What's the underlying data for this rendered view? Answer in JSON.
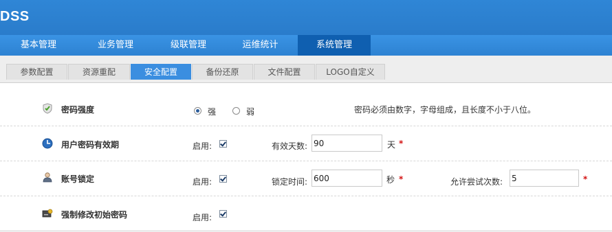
{
  "app": {
    "logo": "DSS"
  },
  "nav": {
    "items": [
      {
        "label": "基本管理"
      },
      {
        "label": "业务管理"
      },
      {
        "label": "级联管理"
      },
      {
        "label": "运维统计"
      },
      {
        "label": "系统管理"
      }
    ],
    "active": "系统管理"
  },
  "subnav": {
    "tabs": [
      {
        "label": "参数配置"
      },
      {
        "label": "资源重配"
      },
      {
        "label": "安全配置"
      },
      {
        "label": "备份还原"
      },
      {
        "label": "文件配置"
      },
      {
        "label": "LOGO自定义"
      }
    ],
    "active": "安全配置"
  },
  "password_strength": {
    "title": "密码强度",
    "options": [
      {
        "label": "强",
        "selected": true
      },
      {
        "label": "弱",
        "selected": false
      }
    ],
    "hint": "密码必须由数字，字母组成，且长度不小于八位。"
  },
  "password_expiry": {
    "title": "用户密码有效期",
    "enable_label": "启用:",
    "enabled": true,
    "days_label": "有效天数:",
    "days_value": "90",
    "days_unit": "天",
    "required_mark": "*"
  },
  "account_lock": {
    "title": "账号锁定",
    "enable_label": "启用:",
    "enabled": true,
    "lock_time_label": "锁定时间:",
    "lock_time_value": "600",
    "lock_time_unit": "秒",
    "attempts_label": "允许尝试次数:",
    "attempts_value": "5",
    "required_mark": "*"
  },
  "force_change": {
    "title": "强制修改初始密码",
    "enable_label": "启用:",
    "enabled": true
  },
  "colors": {
    "header_blue": "#2f86d6",
    "nav_active": "#0f5fb0",
    "tab_active": "#3b8ee0",
    "required_red": "#d31111"
  },
  "icons": {
    "password_strength": "shield-check-icon",
    "password_expiry": "globe-clock-icon",
    "account_lock": "user-icon",
    "force_change": "key-card-icon"
  }
}
